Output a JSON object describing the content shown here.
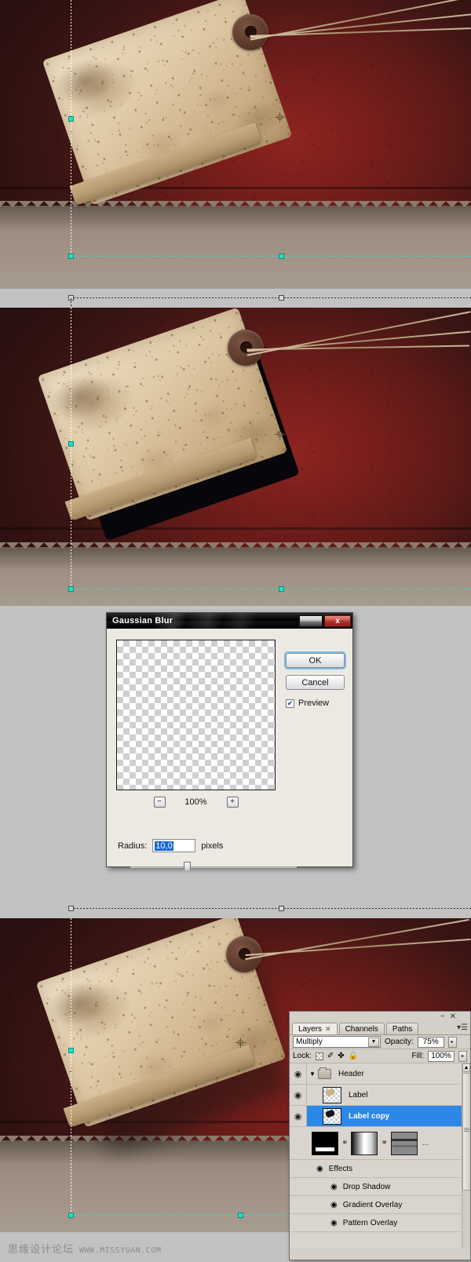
{
  "panels": [
    {
      "name": "step-one-canvas",
      "caption": ""
    },
    {
      "name": "step-two-canvas",
      "caption": ""
    },
    {
      "name": "step-three-canvas",
      "caption": ""
    }
  ],
  "dialog": {
    "title": "Gaussian Blur",
    "minimize_icon": "minimize-icon",
    "close_icon": "close-icon",
    "close_label": "x",
    "ok_label": "OK",
    "cancel_label": "Cancel",
    "preview_label": "Preview",
    "preview_checked": "✔",
    "zoom_out_label": "−",
    "zoom_in_label": "+",
    "zoom_level": "100%",
    "radius_label": "Radius:",
    "radius_value": "10,0",
    "radius_units": "pixels"
  },
  "layers_panel": {
    "minimize_label": "−",
    "close_label": "✕",
    "menu_label": "▾☰",
    "tabs": [
      {
        "label": "Layers",
        "close": "✕",
        "active": true
      },
      {
        "label": "Channels",
        "close": "",
        "active": false
      },
      {
        "label": "Paths",
        "close": "",
        "active": false
      }
    ],
    "blend_mode": "Multiply",
    "blend_arrow": "▼",
    "opacity_label": "Opacity:",
    "opacity_value": "75%",
    "opacity_arrow": "▸",
    "lock_label": "Lock:",
    "lock_icons": [
      "lock-transparency-icon",
      "lock-image-icon",
      "lock-position-icon",
      "lock-all-icon"
    ],
    "lock_brush_glyph": "✐",
    "lock_move_glyph": "✤",
    "lock_all_glyph": "ὑ2",
    "fill_label": "Fill:",
    "fill_value": "100%",
    "fill_arrow": "▸",
    "eye_glyph": "◉",
    "twisty_glyph": "▼",
    "layers": [
      {
        "name": "Header",
        "type": "group",
        "selected": false,
        "visible": true
      },
      {
        "name": "Label",
        "type": "layer",
        "selected": false,
        "visible": true
      },
      {
        "name": "Label copy",
        "type": "layer",
        "selected": true,
        "visible": true
      }
    ],
    "fx_thumbs_more": "...",
    "link_glyph": "⚭",
    "effects_label": "Effects",
    "effects": [
      "Drop Shadow",
      "Gradient Overlay",
      "Pattern Overlay"
    ],
    "scroll_up": "▲",
    "scroll_down": "▼"
  },
  "watermark": {
    "chinese": "思缘设计论坛",
    "url": "WWW.MISSYUAN.COM"
  },
  "colors": {
    "selection_highlight": "#2b87e8",
    "guide_cyan": "#25e0c6",
    "wall_red": "#7a1f1c",
    "paper": "#e8d6b8",
    "dialog_title": "#000000",
    "close_button_red": "#c44b42"
  }
}
